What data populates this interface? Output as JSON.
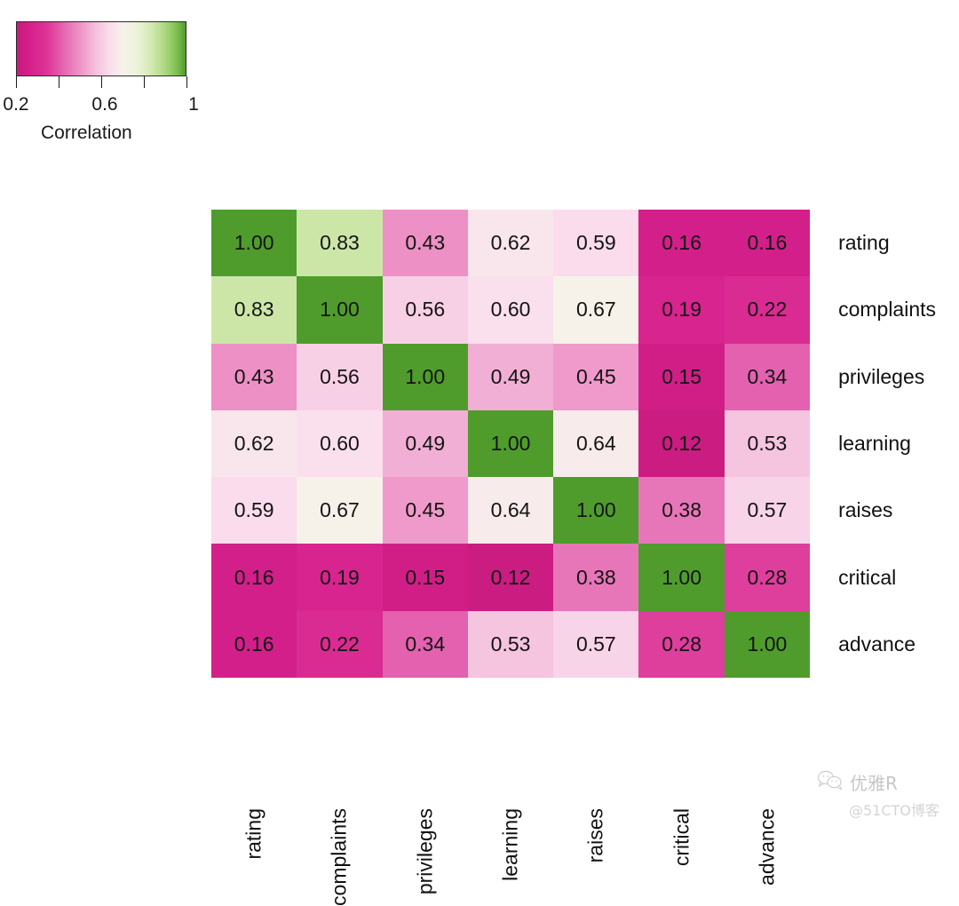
{
  "legend": {
    "title": "Correlation",
    "gradient_from": "#d6208c",
    "gradient_mid": "#f7f4ee",
    "gradient_to": "#4f9c2d",
    "ticks": [
      {
        "value": 0.2,
        "label": "0.2",
        "pos_pct": 0
      },
      {
        "value": 0.4,
        "label": "",
        "pos_pct": 25
      },
      {
        "value": 0.6,
        "label": "0.6",
        "pos_pct": 50
      },
      {
        "value": 0.8,
        "label": "",
        "pos_pct": 75
      },
      {
        "value": 1.0,
        "label": "1",
        "pos_pct": 100
      }
    ]
  },
  "watermark": {
    "icon": "wechat-icon",
    "brand": "优雅R",
    "source": "@51CTO博客"
  },
  "chart_data": {
    "type": "heatmap",
    "title": "",
    "xlabel": "",
    "ylabel": "",
    "colorbar_label": "Correlation",
    "colorscale": "PiYG",
    "zlim": [
      0.1,
      1.0
    ],
    "grid": false,
    "legend_position": "top-left",
    "categories": [
      "rating",
      "complaints",
      "privileges",
      "learning",
      "raises",
      "critical",
      "advance"
    ],
    "x": [
      "rating",
      "complaints",
      "privileges",
      "learning",
      "raises",
      "critical",
      "advance"
    ],
    "y": [
      "rating",
      "complaints",
      "privileges",
      "learning",
      "raises",
      "critical",
      "advance"
    ],
    "values": [
      [
        1.0,
        0.83,
        0.43,
        0.62,
        0.59,
        0.16,
        0.16
      ],
      [
        0.83,
        1.0,
        0.56,
        0.6,
        0.67,
        0.19,
        0.22
      ],
      [
        0.43,
        0.56,
        1.0,
        0.49,
        0.45,
        0.15,
        0.34
      ],
      [
        0.62,
        0.6,
        0.49,
        1.0,
        0.64,
        0.12,
        0.53
      ],
      [
        0.59,
        0.67,
        0.45,
        0.64,
        1.0,
        0.38,
        0.57
      ],
      [
        0.16,
        0.19,
        0.15,
        0.12,
        0.38,
        1.0,
        0.28
      ],
      [
        0.16,
        0.22,
        0.34,
        0.53,
        0.57,
        0.28,
        1.0
      ]
    ],
    "cell_labels": [
      [
        "1.00",
        "0.83",
        "0.43",
        "0.62",
        "0.59",
        "0.16",
        "0.16"
      ],
      [
        "0.83",
        "1.00",
        "0.56",
        "0.60",
        "0.67",
        "0.19",
        "0.22"
      ],
      [
        "0.43",
        "0.56",
        "1.00",
        "0.49",
        "0.45",
        "0.15",
        "0.34"
      ],
      [
        "0.62",
        "0.60",
        "0.49",
        "1.00",
        "0.64",
        "0.12",
        "0.53"
      ],
      [
        "0.59",
        "0.67",
        "0.45",
        "0.64",
        "1.00",
        "0.38",
        "0.57"
      ],
      [
        "0.16",
        "0.19",
        "0.15",
        "0.12",
        "0.38",
        "1.00",
        "0.28"
      ],
      [
        "0.16",
        "0.22",
        "0.34",
        "0.53",
        "0.57",
        "0.28",
        "1.00"
      ]
    ]
  }
}
